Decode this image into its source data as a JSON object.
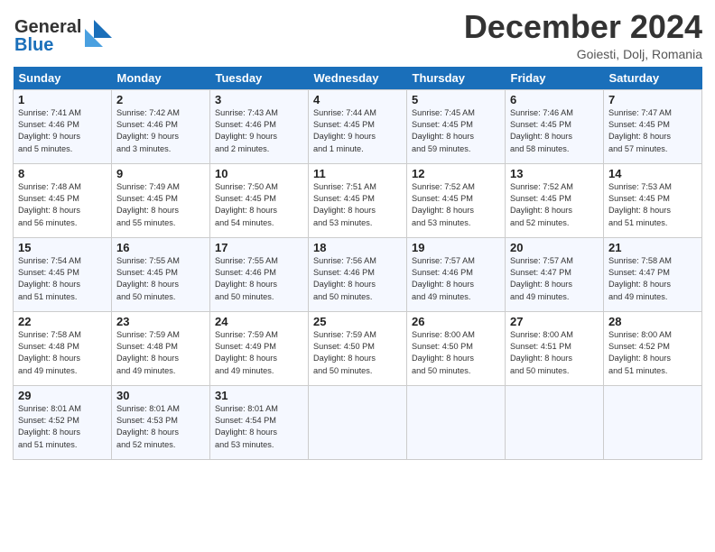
{
  "header": {
    "logo_line1": "General",
    "logo_line2": "Blue",
    "month_title": "December 2024",
    "location": "Goiesti, Dolj, Romania"
  },
  "days_of_week": [
    "Sunday",
    "Monday",
    "Tuesday",
    "Wednesday",
    "Thursday",
    "Friday",
    "Saturday"
  ],
  "weeks": [
    [
      {
        "day": "1",
        "text": "Sunrise: 7:41 AM\nSunset: 4:46 PM\nDaylight: 9 hours\nand 5 minutes."
      },
      {
        "day": "2",
        "text": "Sunrise: 7:42 AM\nSunset: 4:46 PM\nDaylight: 9 hours\nand 3 minutes."
      },
      {
        "day": "3",
        "text": "Sunrise: 7:43 AM\nSunset: 4:46 PM\nDaylight: 9 hours\nand 2 minutes."
      },
      {
        "day": "4",
        "text": "Sunrise: 7:44 AM\nSunset: 4:45 PM\nDaylight: 9 hours\nand 1 minute."
      },
      {
        "day": "5",
        "text": "Sunrise: 7:45 AM\nSunset: 4:45 PM\nDaylight: 8 hours\nand 59 minutes."
      },
      {
        "day": "6",
        "text": "Sunrise: 7:46 AM\nSunset: 4:45 PM\nDaylight: 8 hours\nand 58 minutes."
      },
      {
        "day": "7",
        "text": "Sunrise: 7:47 AM\nSunset: 4:45 PM\nDaylight: 8 hours\nand 57 minutes."
      }
    ],
    [
      {
        "day": "8",
        "text": "Sunrise: 7:48 AM\nSunset: 4:45 PM\nDaylight: 8 hours\nand 56 minutes."
      },
      {
        "day": "9",
        "text": "Sunrise: 7:49 AM\nSunset: 4:45 PM\nDaylight: 8 hours\nand 55 minutes."
      },
      {
        "day": "10",
        "text": "Sunrise: 7:50 AM\nSunset: 4:45 PM\nDaylight: 8 hours\nand 54 minutes."
      },
      {
        "day": "11",
        "text": "Sunrise: 7:51 AM\nSunset: 4:45 PM\nDaylight: 8 hours\nand 53 minutes."
      },
      {
        "day": "12",
        "text": "Sunrise: 7:52 AM\nSunset: 4:45 PM\nDaylight: 8 hours\nand 53 minutes."
      },
      {
        "day": "13",
        "text": "Sunrise: 7:52 AM\nSunset: 4:45 PM\nDaylight: 8 hours\nand 52 minutes."
      },
      {
        "day": "14",
        "text": "Sunrise: 7:53 AM\nSunset: 4:45 PM\nDaylight: 8 hours\nand 51 minutes."
      }
    ],
    [
      {
        "day": "15",
        "text": "Sunrise: 7:54 AM\nSunset: 4:45 PM\nDaylight: 8 hours\nand 51 minutes."
      },
      {
        "day": "16",
        "text": "Sunrise: 7:55 AM\nSunset: 4:45 PM\nDaylight: 8 hours\nand 50 minutes."
      },
      {
        "day": "17",
        "text": "Sunrise: 7:55 AM\nSunset: 4:46 PM\nDaylight: 8 hours\nand 50 minutes."
      },
      {
        "day": "18",
        "text": "Sunrise: 7:56 AM\nSunset: 4:46 PM\nDaylight: 8 hours\nand 50 minutes."
      },
      {
        "day": "19",
        "text": "Sunrise: 7:57 AM\nSunset: 4:46 PM\nDaylight: 8 hours\nand 49 minutes."
      },
      {
        "day": "20",
        "text": "Sunrise: 7:57 AM\nSunset: 4:47 PM\nDaylight: 8 hours\nand 49 minutes."
      },
      {
        "day": "21",
        "text": "Sunrise: 7:58 AM\nSunset: 4:47 PM\nDaylight: 8 hours\nand 49 minutes."
      }
    ],
    [
      {
        "day": "22",
        "text": "Sunrise: 7:58 AM\nSunset: 4:48 PM\nDaylight: 8 hours\nand 49 minutes."
      },
      {
        "day": "23",
        "text": "Sunrise: 7:59 AM\nSunset: 4:48 PM\nDaylight: 8 hours\nand 49 minutes."
      },
      {
        "day": "24",
        "text": "Sunrise: 7:59 AM\nSunset: 4:49 PM\nDaylight: 8 hours\nand 49 minutes."
      },
      {
        "day": "25",
        "text": "Sunrise: 7:59 AM\nSunset: 4:50 PM\nDaylight: 8 hours\nand 50 minutes."
      },
      {
        "day": "26",
        "text": "Sunrise: 8:00 AM\nSunset: 4:50 PM\nDaylight: 8 hours\nand 50 minutes."
      },
      {
        "day": "27",
        "text": "Sunrise: 8:00 AM\nSunset: 4:51 PM\nDaylight: 8 hours\nand 50 minutes."
      },
      {
        "day": "28",
        "text": "Sunrise: 8:00 AM\nSunset: 4:52 PM\nDaylight: 8 hours\nand 51 minutes."
      }
    ],
    [
      {
        "day": "29",
        "text": "Sunrise: 8:01 AM\nSunset: 4:52 PM\nDaylight: 8 hours\nand 51 minutes."
      },
      {
        "day": "30",
        "text": "Sunrise: 8:01 AM\nSunset: 4:53 PM\nDaylight: 8 hours\nand 52 minutes."
      },
      {
        "day": "31",
        "text": "Sunrise: 8:01 AM\nSunset: 4:54 PM\nDaylight: 8 hours\nand 53 minutes."
      },
      {
        "day": "",
        "text": ""
      },
      {
        "day": "",
        "text": ""
      },
      {
        "day": "",
        "text": ""
      },
      {
        "day": "",
        "text": ""
      }
    ]
  ]
}
